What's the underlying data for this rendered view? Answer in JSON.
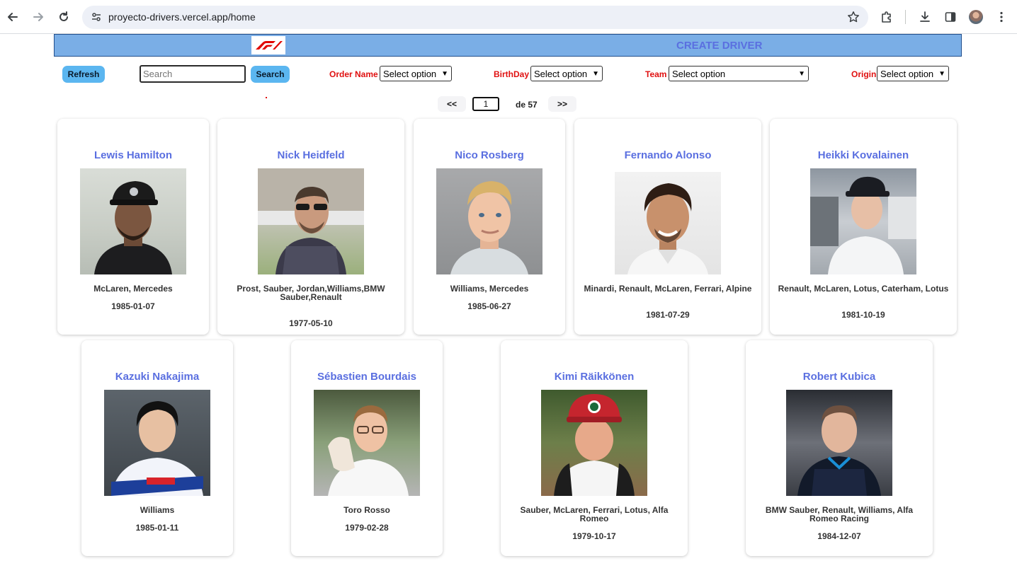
{
  "browser": {
    "url": "proyecto-drivers.vercel.app/home"
  },
  "header": {
    "create_label": "CREATE DRIVER"
  },
  "controls": {
    "refresh_label": "Refresh",
    "search_placeholder": "Search",
    "search_value": "",
    "search_label": "Search",
    "order_label": "Order Name",
    "order_value": "Select option",
    "birthday_label": "BirthDay",
    "birthday_value": "Select option",
    "team_label": "Team",
    "team_value": "Select option",
    "origin_label": "Origin",
    "origin_value": "Select option"
  },
  "pagination": {
    "prev_label": "<<",
    "current_page": "1",
    "total_label": "de 57",
    "next_label": ">>"
  },
  "drivers": [
    {
      "name": "Lewis Hamilton",
      "teams": "McLaren, Mercedes",
      "dob": "1985-01-07"
    },
    {
      "name": "Nick Heidfeld",
      "teams": "Prost, Sauber, Jordan,Williams,BMW Sauber,Renault",
      "dob": "1977-05-10"
    },
    {
      "name": "Nico Rosberg",
      "teams": "Williams, Mercedes",
      "dob": "1985-06-27"
    },
    {
      "name": "Fernando Alonso",
      "teams": "Minardi, Renault, McLaren, Ferrari, Alpine",
      "dob": "1981-07-29"
    },
    {
      "name": "Heikki Kovalainen",
      "teams": "Renault, McLaren, Lotus, Caterham, Lotus",
      "dob": "1981-10-19"
    },
    {
      "name": "Kazuki Nakajima",
      "teams": "Williams",
      "dob": "1985-01-11"
    },
    {
      "name": "Sébastien Bourdais",
      "teams": "Toro Rosso",
      "dob": "1979-02-28"
    },
    {
      "name": "Kimi Räikkönen",
      "teams": "Sauber, McLaren, Ferrari, Lotus, Alfa Romeo",
      "dob": "1979-10-17"
    },
    {
      "name": "Robert Kubica",
      "teams": "BMW Sauber, Renault, Williams, Alfa Romeo Racing",
      "dob": "1984-12-07"
    }
  ]
}
